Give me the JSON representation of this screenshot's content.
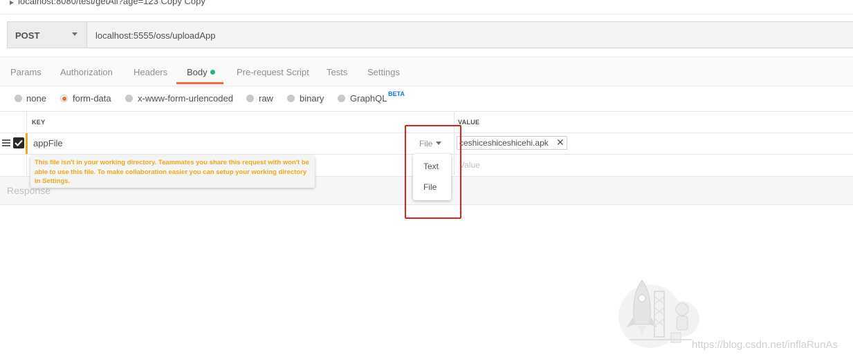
{
  "breadcrumb": "localhost:8080/test/getAll?age=123 Copy Copy",
  "request": {
    "method": "POST",
    "url": "localhost:5555/oss/uploadApp"
  },
  "tabs": [
    {
      "label": "Params"
    },
    {
      "label": "Authorization"
    },
    {
      "label": "Headers"
    },
    {
      "label": "Body",
      "active": true
    },
    {
      "label": "Pre-request Script"
    },
    {
      "label": "Tests"
    },
    {
      "label": "Settings"
    }
  ],
  "body_types": [
    {
      "label": "none"
    },
    {
      "label": "form-data",
      "selected": true
    },
    {
      "label": "x-www-form-urlencoded"
    },
    {
      "label": "raw"
    },
    {
      "label": "binary"
    },
    {
      "label": "GraphQL"
    }
  ],
  "graphql_badge": "BETA",
  "table": {
    "key_header": "KEY",
    "value_header": "VALUE",
    "row": {
      "key": "appFile",
      "type": "File",
      "file_name": "ceshiceshiceshicehi.apk",
      "remove_icon": "✕"
    },
    "value_placeholder": "Value"
  },
  "tooltip": "This file isn't in your working directory. Teammates you share this request with won't be able to use this file. To make collaboration easier you can setup your working directory in Settings.",
  "type_dropdown": {
    "options": [
      "Text",
      "File"
    ]
  },
  "response_label": "Response",
  "watermark": "https://blog.csdn.net/inflaRunAs",
  "colors": {
    "accent": "#f26b3a",
    "status_dot": "#26b47f",
    "warning": "#f0a81a",
    "beta": "#097bed",
    "annotation_box": "#e02020"
  }
}
